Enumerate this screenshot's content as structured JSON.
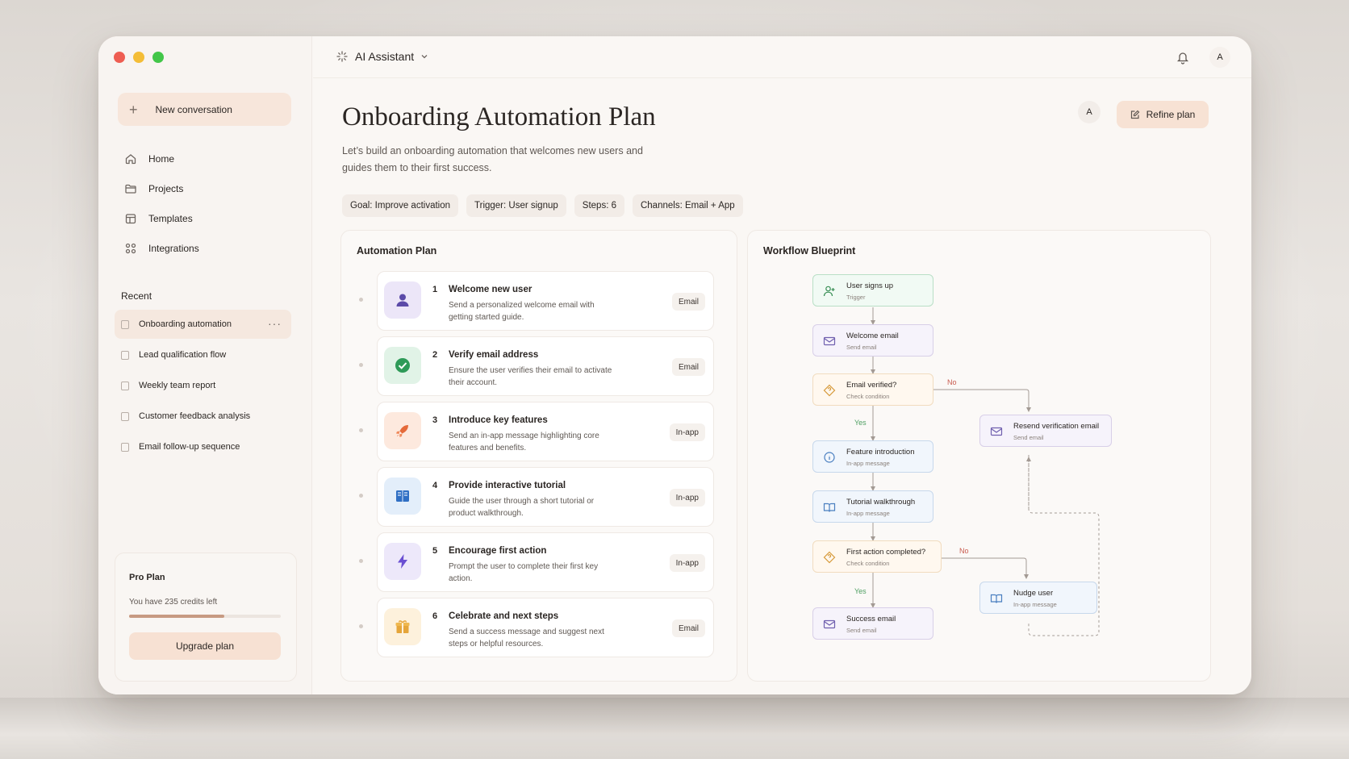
{
  "sidebar": {
    "new_conversation": "New conversation",
    "nav": [
      "Home",
      "Projects",
      "Templates",
      "Integrations"
    ],
    "recent_heading": "Recent",
    "recent": [
      "Onboarding automation",
      "Lead qualification flow",
      "Weekly team report",
      "Customer feedback analysis",
      "Email follow-up sequence"
    ],
    "pro": {
      "title": "Pro Plan",
      "credits": "You have 235 credits left",
      "usage_fraction": 0.63,
      "upgrade": "Upgrade plan"
    }
  },
  "topbar": {
    "assistant": "AI Assistant",
    "avatar": "A"
  },
  "main": {
    "title": "Onboarding Automation Plan",
    "description": "Let’s build an onboarding automation that welcomes new users and guides them to their first success.",
    "avatar": "A",
    "refine": "Refine plan",
    "chips": [
      "Goal:  Improve activation",
      "Trigger:  User signup",
      "Steps:  6",
      "Channels:  Email + App"
    ]
  },
  "plan": {
    "title": "Automation Plan",
    "steps": [
      {
        "num": "1",
        "title": "Welcome new user",
        "desc": "Send a personalized welcome email with getting started guide.",
        "tag": "Email",
        "icon": "user-icon",
        "bg": "#ece6f8",
        "fg": "#5b4aa8"
      },
      {
        "num": "2",
        "title": "Verify email address",
        "desc": "Ensure the user verifies their email to activate their account.",
        "tag": "Email",
        "icon": "check-icon",
        "bg": "#e1f3e7",
        "fg": "#2e9a58"
      },
      {
        "num": "3",
        "title": "Introduce key features",
        "desc": "Send an in-app message highlighting core features and benefits.",
        "tag": "In-app",
        "icon": "rocket-icon",
        "bg": "#fde9de",
        "fg": "#e56a3a"
      },
      {
        "num": "4",
        "title": "Provide interactive tutorial",
        "desc": "Guide the user through a short tutorial or product walkthrough.",
        "tag": "In-app",
        "icon": "book-icon",
        "bg": "#e3eefa",
        "fg": "#2f6fc4"
      },
      {
        "num": "5",
        "title": "Encourage first action",
        "desc": "Prompt the user to complete their first key action.",
        "tag": "In-app",
        "icon": "lightning-icon",
        "bg": "#ede8fa",
        "fg": "#6a4fd2"
      },
      {
        "num": "6",
        "title": "Celebrate and next steps",
        "desc": "Send a success message and suggest next steps or helpful resources.",
        "tag": "Email",
        "icon": "gift-icon",
        "bg": "#fdf1dc",
        "fg": "#e5a53a"
      }
    ]
  },
  "blueprint": {
    "title": "Workflow Blueprint",
    "nodes": {
      "signup": {
        "title": "User signs up",
        "sub": "Trigger"
      },
      "welcome": {
        "title": "Welcome email",
        "sub": "Send email"
      },
      "verified": {
        "title": "Email verified?",
        "sub": "Check condition"
      },
      "resend": {
        "title": "Resend verification email",
        "sub": "Send email"
      },
      "feature": {
        "title": "Feature introduction",
        "sub": "In-app message"
      },
      "tutorial": {
        "title": "Tutorial walkthrough",
        "sub": "In-app message"
      },
      "first_action": {
        "title": "First action completed?",
        "sub": "Check condition"
      },
      "nudge": {
        "title": "Nudge user",
        "sub": "In-app message"
      },
      "success": {
        "title": "Success email",
        "sub": "Send email"
      }
    },
    "labels": {
      "no": "No",
      "yes": "Yes"
    }
  }
}
